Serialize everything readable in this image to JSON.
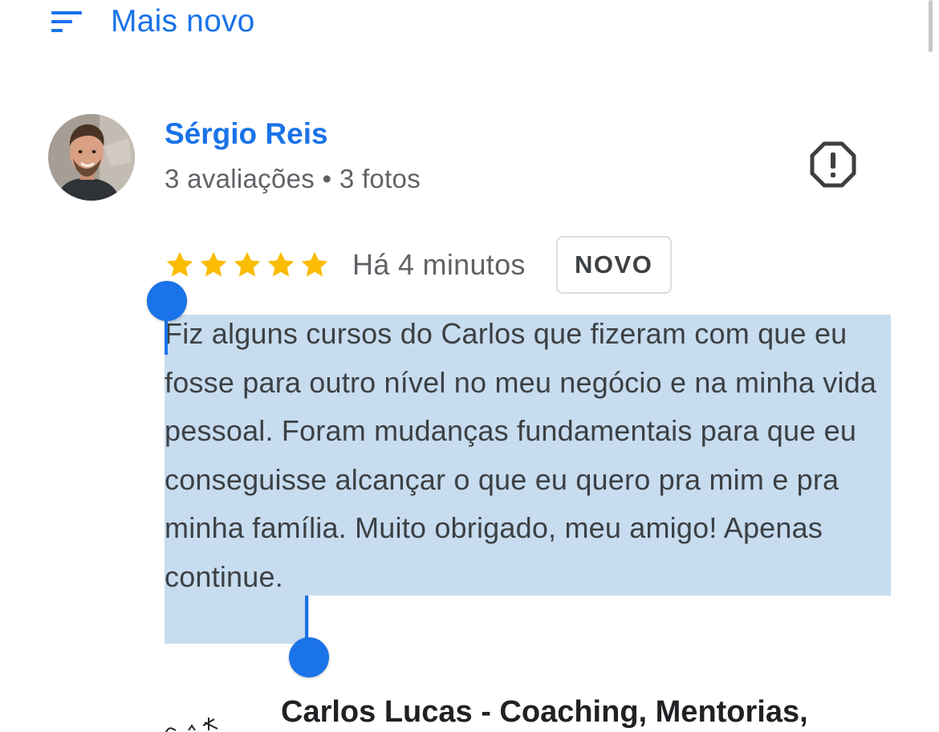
{
  "sort": {
    "icon": "sort-icon",
    "label": "Mais novo"
  },
  "review": {
    "reviewer_name": "Sérgio Reis",
    "reviewer_meta": "3 avaliações • 3 fotos",
    "avatar_icon": "profile-photo",
    "report_icon": "report-flag-icon",
    "rating": 5,
    "rating_max": 5,
    "time": "Há 4 minutos",
    "badge": "NOVO",
    "text": "Fiz alguns cursos do Carlos que fizeram com que eu fosse para outro nível no meu negócio e na minha vida pessoal. Foram mudanças fundamentais para que eu conseguisse alcançar o que eu quero pra mim e pra minha família. Muito obrigado, meu amigo! Apenas continue."
  },
  "owner_response": {
    "name": "Carlos Lucas - Coaching, Mentorias,"
  },
  "colors": {
    "accent": "#1a73e8",
    "star": "#fbbc04",
    "selection": "#c7dcef",
    "text": "#3c4043",
    "secondary_text": "#5f6368"
  }
}
